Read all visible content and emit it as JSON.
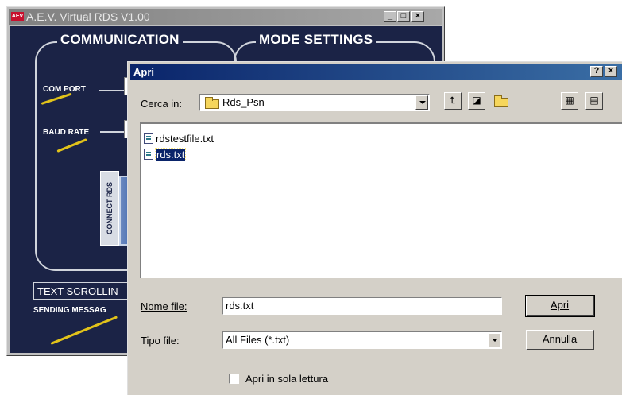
{
  "app_window": {
    "logo": "AEV",
    "title": "A.E.V. Virtual RDS V1.00",
    "sections": {
      "communication": "COMMUNICATION",
      "mode_settings": "MODE SETTINGS"
    },
    "labels": {
      "com_port": "COM PORT",
      "baud_rate": "BAUD RATE",
      "connect_rds": "CONNECT RDS",
      "text_scrolling": "TEXT SCROLLIN",
      "sending_message": "SENDING MESSAG"
    }
  },
  "dialog": {
    "title": "Apri",
    "help_glyph": "?",
    "close_glyph": "×",
    "look_in_label": "Cerca in:",
    "look_in_value": "Rds_Psn",
    "files": [
      {
        "name": "rdstestfile.txt",
        "selected": false
      },
      {
        "name": "rds.txt",
        "selected": true
      }
    ],
    "filename_label": "Nome file:",
    "filename_value": "rds.txt",
    "filetype_label": "Tipo file:",
    "filetype_value": "All Files (*.txt)",
    "open_button": "Apri",
    "cancel_button": "Annulla",
    "readonly_label": "Apri in sola lettura"
  }
}
